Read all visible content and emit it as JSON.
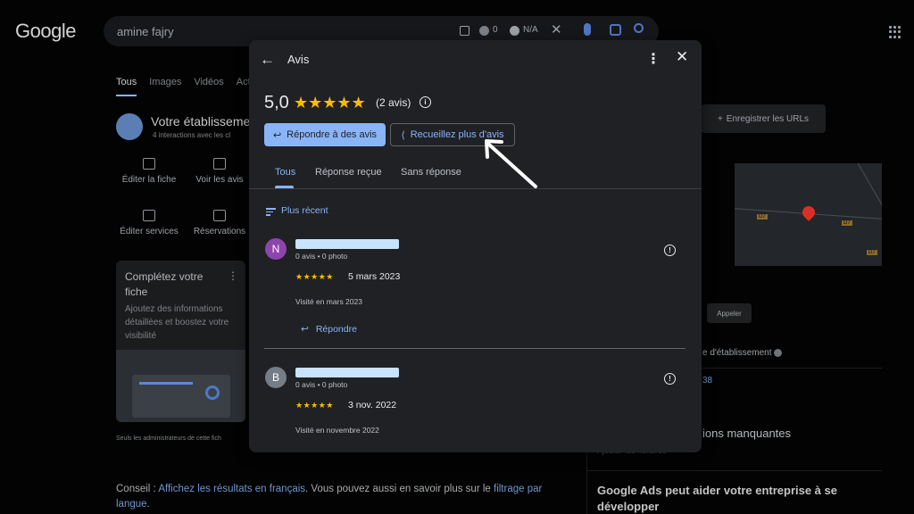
{
  "search": {
    "logo": "Google",
    "query": "amine fajry",
    "counter": "0",
    "na": "N/A",
    "tabs": [
      "Tous",
      "Images",
      "Vidéos",
      "Act"
    ]
  },
  "business": {
    "title": "Votre établissement",
    "subtitle": "4 interactions avec les cl",
    "actions": [
      "Éditer la fiche",
      "Voir les avis",
      "Éditer services",
      "Réservations"
    ],
    "complete_card": {
      "title": "Complétez votre fiche",
      "desc": "Ajoutez des informations détaillées et boostez votre visibilité"
    },
    "admin_note": "Seuls les administrateurs de cette fich"
  },
  "right_panel": {
    "register_urls": "Enregistrer les URLs",
    "call": "Appeler",
    "etab": "e d'établissement",
    "number": "38",
    "missing": "ions manquantes",
    "hours": "Ajouter les horaires",
    "ads": "Google Ads peut aider votre entreprise à se développer",
    "map_tags": [
      "D7",
      "D7",
      "D7"
    ]
  },
  "conseil": {
    "prefix": "Conseil : ",
    "link1": "Affichez les résultats en",
    "link2": "français",
    "middle": ". Vous pouvez aussi en savoir plus sur le ",
    "link3": "filtrage par langue",
    "suffix": "."
  },
  "modal": {
    "title": "Avis",
    "rating": "5,0",
    "stars": "★★★★★",
    "count": "(2 avis)",
    "reply_button": "Répondre à des avis",
    "collect_button": "Recueillez plus d'avis",
    "tabs": [
      "Tous",
      "Réponse reçue",
      "Sans réponse"
    ],
    "sort_label": "Plus récent",
    "reviews": [
      {
        "initial": "N",
        "avatar_color": "#8e44ad",
        "meta": "0 avis • 0 photo",
        "stars": "★★★★★",
        "date": "5 mars 2023",
        "visited": "Visité en mars 2023",
        "reply_label": "Répondre"
      },
      {
        "initial": "B",
        "avatar_color": "#757d86",
        "meta": "0 avis • 0 photo",
        "stars": "★★★★★",
        "date": "3 nov. 2022",
        "visited": "Visité en novembre 2022"
      }
    ]
  },
  "colors": {
    "accent": "#8ab4f8",
    "star": "#fbbc04",
    "modal_bg": "#202124"
  }
}
